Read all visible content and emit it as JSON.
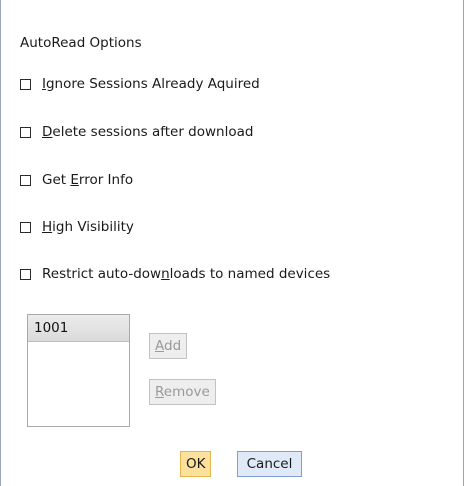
{
  "dialog": {
    "title": "AutoRead Options",
    "options": [
      {
        "pre": "",
        "ul": "I",
        "post": "gnore Sessions Already Aquired",
        "checked": false
      },
      {
        "pre": "",
        "ul": "D",
        "post": "elete sessions after download",
        "checked": false
      },
      {
        "pre": "Get ",
        "ul": "E",
        "post": "rror Info",
        "checked": false
      },
      {
        "pre": "",
        "ul": "H",
        "post": "igh Visibility",
        "checked": false
      },
      {
        "pre": "Restrict auto-dow",
        "ul": "n",
        "post": "loads to named devices",
        "checked": false
      }
    ],
    "devices": [
      "1001"
    ],
    "buttons": {
      "add": {
        "ul": "A",
        "post": "dd"
      },
      "remove": {
        "ul": "R",
        "post": "emove"
      },
      "ok": "OK",
      "cancel": "Cancel"
    }
  }
}
